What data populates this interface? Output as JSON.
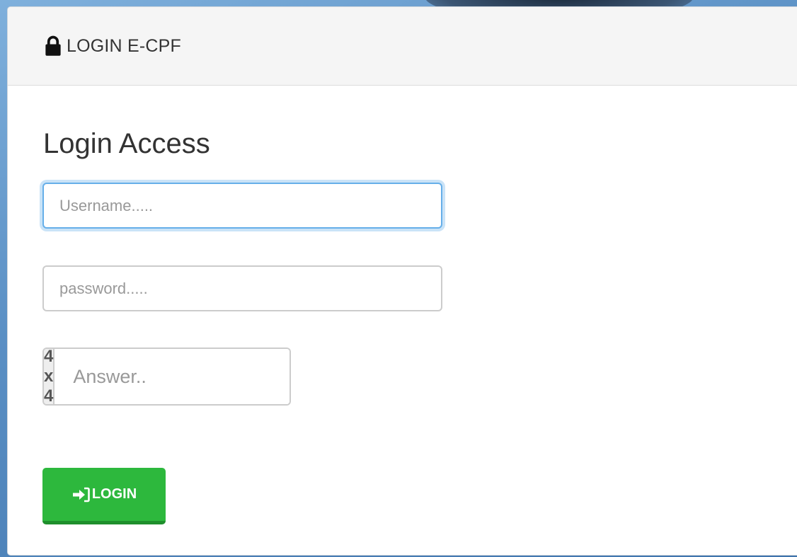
{
  "header": {
    "title": "LOGIN E-CPF",
    "icon": "lock-icon"
  },
  "form": {
    "heading": "Login Access",
    "username": {
      "value": "",
      "placeholder": "Username....."
    },
    "password": {
      "value": "",
      "placeholder": "password....."
    },
    "captcha": {
      "question": "4 x 4",
      "answer": {
        "value": "",
        "placeholder": "Answer.."
      }
    },
    "submit": {
      "label": "LOGIN",
      "icon": "sign-in-icon"
    }
  },
  "colors": {
    "focus_border": "#66afe9",
    "button": "#2db83d",
    "button_shadow": "#1f8f2c"
  }
}
